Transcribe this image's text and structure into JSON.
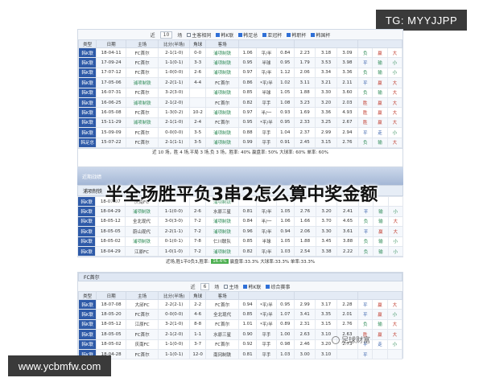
{
  "tg_badge": "TG: MYYJJPP",
  "bottom_badge": "www.ycbmfw.com",
  "overlay_title": "半全场胜平负3串2怎么算中奖金额",
  "watermark": "足球财富",
  "top_panel": {
    "filters": {
      "prefix": "近",
      "count": "10",
      "suffix": "场",
      "checkboxes": [
        "主客相同",
        "韩K联",
        "韩足总",
        "亚冠杯",
        "韩职杯",
        "韩国杯"
      ]
    },
    "headers": [
      "类型",
      "日期",
      "主场",
      "比分(半场)",
      "角球",
      "客场",
      "",
      "",
      "",
      "",
      "",
      "",
      "",
      ""
    ],
    "rows": [
      {
        "type": "韩K联",
        "date": "18-04-11",
        "home": "FC首尔",
        "score": "2-1(1-0)",
        "corner": "0-0",
        "away": "浦项制铁",
        "o1": "1.06",
        "o2": "平/半",
        "o3": "0.84",
        "o4": "2.23",
        "o5": "3.18",
        "o6": "3.09",
        "r1": "负",
        "r2": "赢",
        "r3": "大"
      },
      {
        "type": "韩K联",
        "date": "17-09-24",
        "home": "FC首尔",
        "score": "1-1(0-1)",
        "corner": "3-3",
        "away": "浦项制铁",
        "o1": "0.95",
        "o2": "半球",
        "o3": "0.95",
        "o4": "1.79",
        "o5": "3.53",
        "o6": "3.98",
        "r1": "平",
        "r2": "输",
        "r3": "小"
      },
      {
        "type": "韩K联",
        "date": "17-07-12",
        "home": "FC首尔",
        "score": "1-0(0-0)",
        "corner": "2-6",
        "away": "浦项制铁",
        "o1": "0.97",
        "o2": "平/半",
        "o3": "1.12",
        "o4": "2.06",
        "o5": "3.34",
        "o6": "3.36",
        "r1": "负",
        "r2": "输",
        "r3": "小"
      },
      {
        "type": "韩K联",
        "date": "17-05-06",
        "home": "浦项制铁",
        "score": "2-2(1-1)",
        "corner": "4-4",
        "away": "FC首尔",
        "o1": "0.86",
        "o2": "*平/半",
        "o3": "1.02",
        "o4": "3.11",
        "o5": "3.21",
        "o6": "2.11",
        "r1": "平",
        "r2": "赢",
        "r3": "大"
      },
      {
        "type": "韩K联",
        "date": "16-07-31",
        "home": "FC首尔",
        "score": "3-2(3-0)",
        "corner": "",
        "away": "浦项制铁",
        "o1": "0.85",
        "o2": "半球",
        "o3": "1.05",
        "o4": "1.88",
        "o5": "3.30",
        "o6": "3.60",
        "r1": "负",
        "r2": "输",
        "r3": "大"
      },
      {
        "type": "韩K联",
        "date": "16-06-25",
        "home": "浦项制铁",
        "score": "2-1(2-0)",
        "corner": "",
        "away": "FC首尔",
        "o1": "0.82",
        "o2": "平手",
        "o3": "1.08",
        "o4": "3.23",
        "o5": "3.20",
        "o6": "2.03",
        "r1": "胜",
        "r2": "赢",
        "r3": "大"
      },
      {
        "type": "韩K联",
        "date": "16-05-08",
        "home": "FC首尔",
        "score": "1-3(0-2)",
        "corner": "10-2",
        "away": "浦项制铁",
        "o1": "0.97",
        "o2": "半/一",
        "o3": "0.93",
        "o4": "1.69",
        "o5": "3.36",
        "o6": "4.93",
        "r1": "胜",
        "r2": "赢",
        "r3": "大"
      },
      {
        "type": "韩K联",
        "date": "15-11-29",
        "home": "浦项制铁",
        "score": "2-1(1-0)",
        "corner": "2-4",
        "away": "FC首尔",
        "o1": "0.95",
        "o2": "*平/半",
        "o3": "0.95",
        "o4": "2.33",
        "o5": "3.25",
        "o6": "2.67",
        "r1": "胜",
        "r2": "赢",
        "r3": "大"
      },
      {
        "type": "韩K联",
        "date": "15-09-09",
        "home": "FC首尔",
        "score": "0-0(0-0)",
        "corner": "3-5",
        "away": "浦项制铁",
        "o1": "0.88",
        "o2": "平手",
        "o3": "1.04",
        "o4": "2.37",
        "o5": "2.99",
        "o6": "2.94",
        "r1": "平",
        "r2": "走",
        "r3": "小"
      },
      {
        "type": "韩足总",
        "date": "15-07-22",
        "home": "FC首尔",
        "score": "2-1(1-1)",
        "corner": "3-5",
        "away": "浦项制铁",
        "o1": "0.99",
        "o2": "平手",
        "o3": "0.91",
        "o4": "2.45",
        "o5": "3.15",
        "o6": "2.76",
        "r1": "负",
        "r2": "输",
        "r3": "大"
      }
    ],
    "summary": "近 10 场，胜 4 场,平局 3 场,负 3 场，胜率: 40% 赢盘率: 50% 大球率: 60% 单率: 60%"
  },
  "middle_panel": {
    "bar": "近期战绩",
    "team": "浦项制铁",
    "rows": [
      {
        "type": "韩K联",
        "date": "18-07-07",
        "home": "庆南FC",
        "score": "",
        "corner": "",
        "away": "浦项制铁",
        "o1": "",
        "o2": "",
        "o3": "",
        "o4": "",
        "o5": "",
        "o6": "",
        "r1": "",
        "r2": "",
        "r3": ""
      },
      {
        "type": "韩K联",
        "date": "18-04-29",
        "home": "浦项制铁",
        "score": "1-1(0-0)",
        "corner": "2-6",
        "away": "水原三星",
        "o1": "0.81",
        "o2": "平/半",
        "o3": "1.05",
        "o4": "2.76",
        "o5": "3.20",
        "o6": "2.41",
        "r1": "平",
        "r2": "输",
        "r3": "小"
      },
      {
        "type": "韩K联",
        "date": "18-05-12",
        "home": "全北现代",
        "score": "3-0(3-0)",
        "corner": "7-2",
        "away": "浦项制铁",
        "o1": "0.84",
        "o2": "半/一",
        "o3": "1.06",
        "o4": "1.66",
        "o5": "3.70",
        "o6": "4.65",
        "r1": "负",
        "r2": "输",
        "r3": "大"
      },
      {
        "type": "韩K联",
        "date": "18-05-05",
        "home": "蔚山现代",
        "score": "2-2(1-1)",
        "corner": "7-2",
        "away": "浦项制铁",
        "o1": "0.96",
        "o2": "平/半",
        "o3": "0.94",
        "o4": "2.06",
        "o5": "3.30",
        "o6": "3.61",
        "r1": "平",
        "r2": "赢",
        "r3": "大"
      },
      {
        "type": "韩K联",
        "date": "18-05-02",
        "home": "浦项制铁",
        "score": "0-1(0-1)",
        "corner": "7-8",
        "away": "仁川联队",
        "o1": "0.85",
        "o2": "半球",
        "o3": "1.05",
        "o4": "1.88",
        "o5": "3.45",
        "o6": "3.88",
        "r1": "负",
        "r2": "输",
        "r3": "小"
      },
      {
        "type": "韩K联",
        "date": "18-04-29",
        "home": "江原FC",
        "score": "1-0(1-0)",
        "corner": "7-2",
        "away": "浦项制铁",
        "o1": "0.82",
        "o2": "平/半",
        "o3": "1.03",
        "o4": "2.54",
        "o5": "3.38",
        "o6": "2.22",
        "r1": "负",
        "r2": "输",
        "r3": "小"
      }
    ],
    "summary_pre": "近场,胜1平0负3,胜率:",
    "summary_pct": "16.6%",
    "summary_post": "赢盘率:33.3% 大球率:33.3% 单率:33.3%"
  },
  "bottom_panel": {
    "team": "FC首尔",
    "filters": {
      "prefix": "近",
      "count": "6",
      "suffix": "场",
      "checkboxes": [
        "主场",
        "韩K联",
        "综合赛事"
      ]
    },
    "headers": [
      "类型",
      "日期",
      "主场",
      "比分(半场)",
      "角球",
      "客场",
      "",
      "",
      "",
      "",
      "",
      "",
      "",
      ""
    ],
    "rows": [
      {
        "type": "韩K联",
        "date": "18-07-08",
        "home": "大邱FC",
        "score": "2-2(2-1)",
        "corner": "2-2",
        "away": "FC首尔",
        "o1": "0.94",
        "o2": "*平/半",
        "o3": "0.95",
        "o4": "2.99",
        "o5": "3.17",
        "o6": "2.28",
        "r1": "平",
        "r2": "赢",
        "r3": "大"
      },
      {
        "type": "韩K联",
        "date": "18-05-20",
        "home": "FC首尔",
        "score": "0-0(0-0)",
        "corner": "4-6",
        "away": "全北现代",
        "o1": "0.85",
        "o2": "*平/半",
        "o3": "1.07",
        "o4": "3.41",
        "o5": "3.35",
        "o6": "2.01",
        "r1": "平",
        "r2": "赢",
        "r3": "小"
      },
      {
        "type": "韩K联",
        "date": "18-05-12",
        "home": "江原FC",
        "score": "3-2(1-0)",
        "corner": "8-8",
        "away": "FC首尔",
        "o1": "1.01",
        "o2": "*平/半",
        "o3": "0.89",
        "o4": "2.31",
        "o5": "3.15",
        "o6": "2.76",
        "r1": "负",
        "r2": "输",
        "r3": "大"
      },
      {
        "type": "韩K联",
        "date": "18-05-05",
        "home": "FC首尔",
        "score": "2-1(2-0)",
        "corner": "1-1",
        "away": "水原三星",
        "o1": "0.90",
        "o2": "平手",
        "o3": "1.00",
        "o4": "2.63",
        "o5": "3.10",
        "o6": "2.63",
        "r1": "胜",
        "r2": "赢",
        "r3": "大"
      },
      {
        "type": "韩K联",
        "date": "18-05-02",
        "home": "庆南FC",
        "score": "1-1(0-0)",
        "corner": "3-7",
        "away": "FC首尔",
        "o1": "0.92",
        "o2": "平手",
        "o3": "0.98",
        "o4": "2.46",
        "o5": "3.20",
        "o6": "2.73",
        "r1": "平",
        "r2": "走",
        "r3": "小"
      },
      {
        "type": "韩K联",
        "date": "18-04-28",
        "home": "FC首尔",
        "score": "1-1(0-1)",
        "corner": "12-0",
        "away": "南冈制铁",
        "o1": "0.81",
        "o2": "平手",
        "o3": "1.03",
        "o4": "3.00",
        "o5": "3.10",
        "o6": "",
        "r1": "平",
        "r2": "",
        "r3": ""
      }
    ]
  }
}
